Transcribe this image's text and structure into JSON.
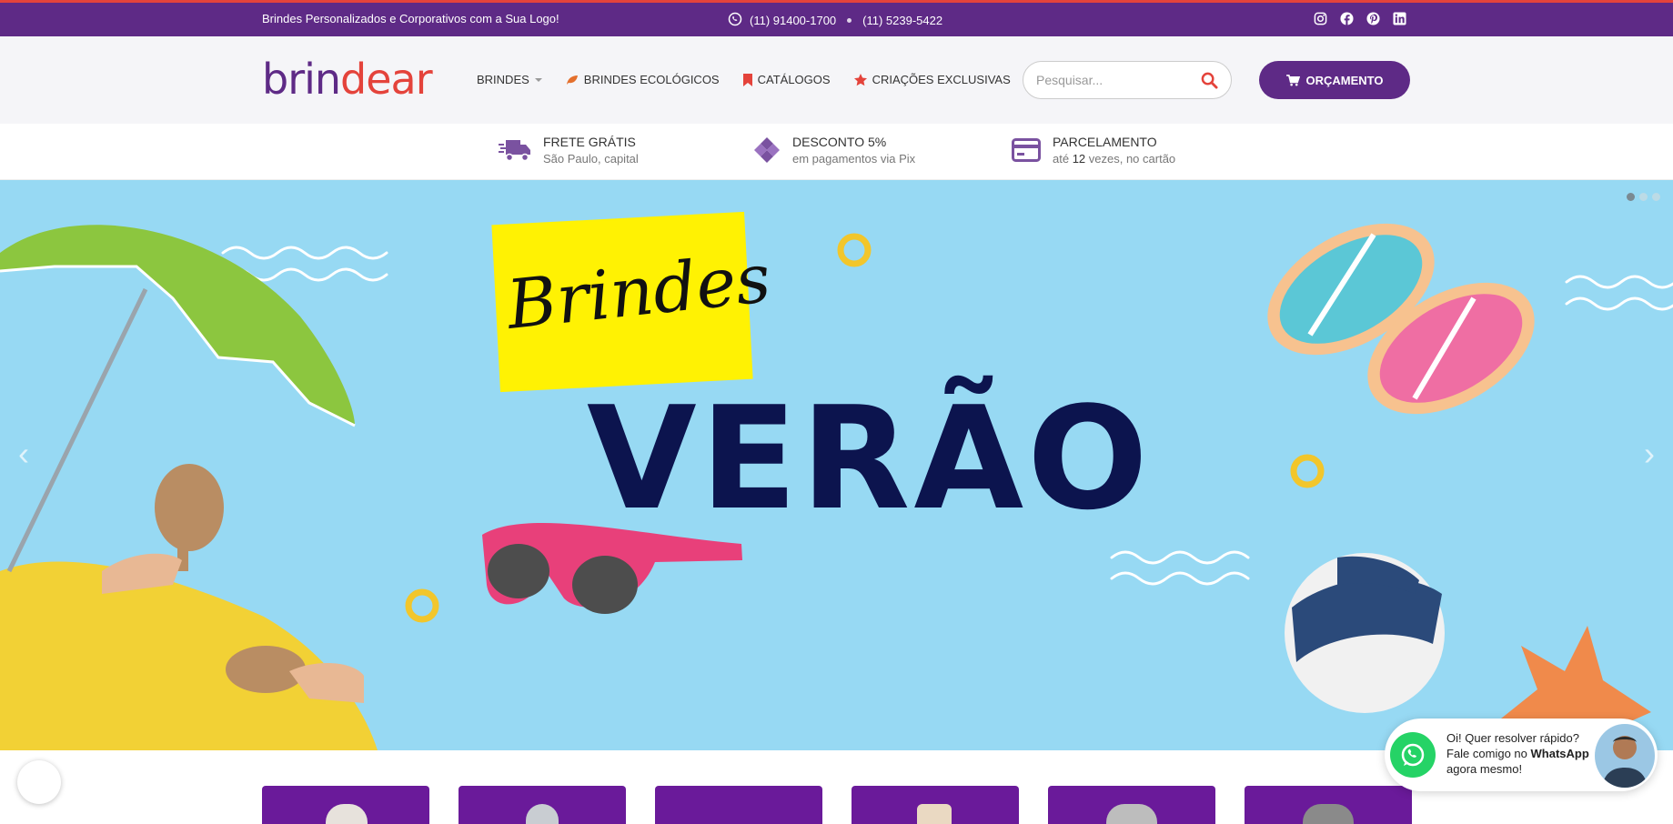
{
  "topbar": {
    "tagline": "Brindes Personalizados e Corporativos com a Sua Logo!",
    "phone1": "(11) 91400-1700",
    "phone2": "(11) 5239-5422",
    "social": [
      "instagram-icon",
      "facebook-icon",
      "pinterest-icon",
      "linkedin-icon"
    ]
  },
  "header": {
    "logo_part1": "brin",
    "logo_part2": "dear",
    "nav": [
      {
        "label": "BRINDES",
        "icon": "chevron-down-icon"
      },
      {
        "label": "BRINDES ECOLÓGICOS",
        "icon": "leaf-icon"
      },
      {
        "label": "CATÁLOGOS",
        "icon": "bookmark-icon"
      },
      {
        "label": "CRIAÇÕES EXCLUSIVAS",
        "icon": "star-icon"
      }
    ],
    "search_placeholder": "Pesquisar...",
    "budget_label": "ORÇAMENTO"
  },
  "benefits": [
    {
      "title": "FRETE GRÁTIS",
      "subtitle": "São Paulo, capital",
      "icon": "truck-icon"
    },
    {
      "title": "DESCONTO 5%",
      "subtitle": "em pagamentos via Pix",
      "icon": "pix-icon"
    },
    {
      "title": "PARCELAMENTO",
      "subtitle_pre": "até ",
      "subtitle_num": "12",
      "subtitle_post": " vezes, no cartão",
      "icon": "credit-card-icon"
    }
  ],
  "hero": {
    "title_script": "Brindes",
    "title_big": "VERÃO",
    "prev": "‹",
    "next": "›",
    "slides": 3,
    "active_slide": 1
  },
  "whatsapp": {
    "line1": "Oi! Quer resolver rápido?",
    "line2_pre": "Fale comigo no ",
    "line2_bold": "WhatsApp",
    "line3": "agora mesmo!"
  },
  "colors": {
    "brand_purple": "#5e2a86",
    "brand_red": "#e4433b",
    "hero_bg": "#97d9f3",
    "card_purple": "#6a1a9a",
    "whatsapp_green": "#25d366"
  }
}
